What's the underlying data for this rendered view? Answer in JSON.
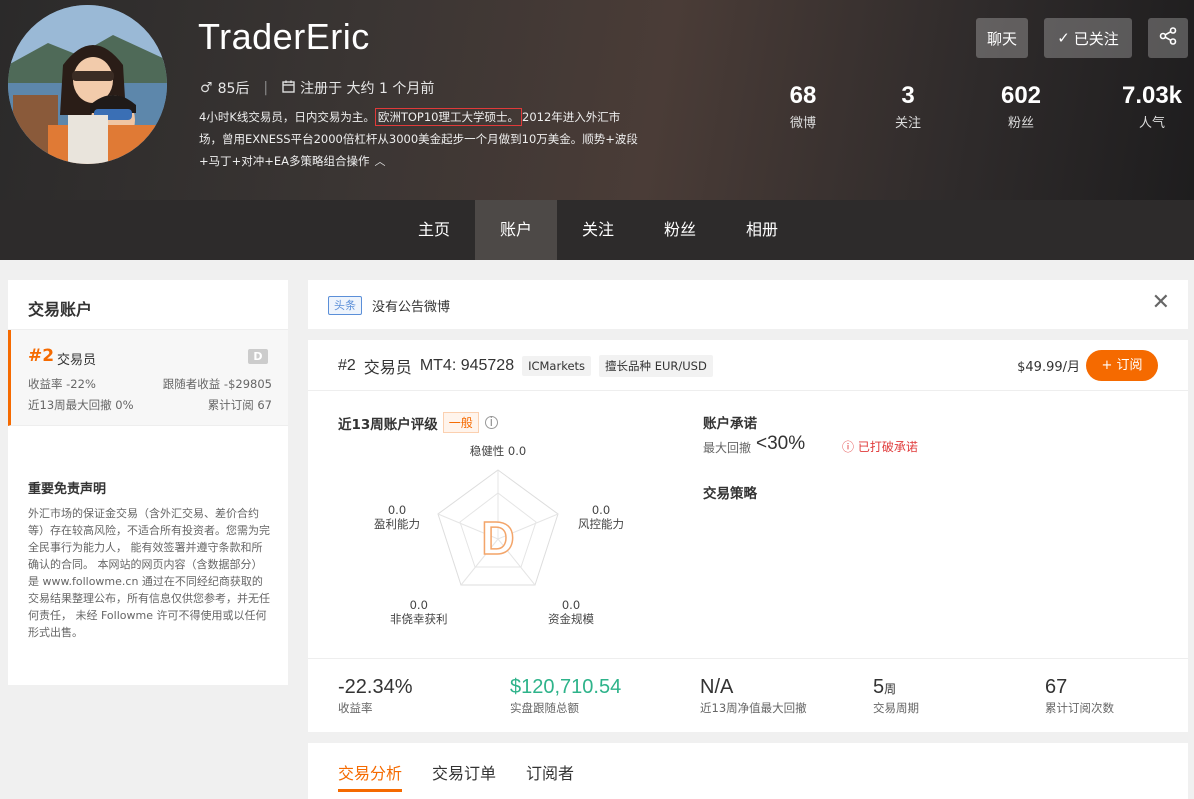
{
  "header": {
    "username": "TraderEric",
    "gender_icon": "male-icon",
    "age_group": "85后",
    "calendar_icon": "calendar-icon",
    "registered": "注册于 大约 1 个月前",
    "bio_part1": "4小时K线交易员，日内交易为主。",
    "bio_highlight": "欧洲TOP10理工大学硕士。",
    "bio_part2": "2012年进入外汇市场，曾用EXNESS平台2000倍杠杆从3000美金起步一个月做到10万美金。顺势+波段+马丁+对冲+EA多策略组合操作",
    "collapse_icon": "chevron-up-icon",
    "buttons": {
      "chat": "聊天",
      "follow": "已关注",
      "follow_icon": "check-icon",
      "share_icon": "share-icon"
    },
    "stats": [
      {
        "num": "68",
        "label": "微博"
      },
      {
        "num": "3",
        "label": "关注"
      },
      {
        "num": "602",
        "label": "粉丝"
      },
      {
        "num": "7.03k",
        "label": "人气"
      }
    ]
  },
  "nav": {
    "tabs": [
      "主页",
      "账户",
      "关注",
      "粉丝",
      "相册"
    ],
    "active": "账户"
  },
  "sidebar": {
    "title": "交易账户",
    "account": {
      "rank": "#2",
      "rank_label": "交易员",
      "grade": "D",
      "return_label": "收益率 -22%",
      "follower_profit_label": "跟随者收益 -$29805",
      "drawdown_label": "近13周最大回撤 0%",
      "subs_label": "累计订阅 67"
    },
    "disclaimer_title": "重要免责声明",
    "disclaimer_text": "外汇市场的保证金交易（含外汇交易、差价合约等）存在较高风险，不适合所有投资者。您需为完全民事行为能力人， 能有效签署并遵守条款和所确认的合同。 本网站的网页内容（含数据部分）是 www.followme.cn 通过在不同经纪商获取的交易结果整理公布，所有信息仅供您参考，并无任何责任， 未经 Followme 许可不得使用或以任何形式出售。"
  },
  "announcement": {
    "tag": "头条",
    "text": "没有公告微博",
    "close_icon": "close-icon"
  },
  "account_detail": {
    "rank": "#2",
    "role": "交易员",
    "mt4": "MT4: 945728",
    "broker": "ICMarkets",
    "specialty": "擅长品种 EUR/USD",
    "price": "$49.99/月",
    "subscribe": "+ 订阅",
    "rating_title": "近13周账户评级",
    "rating_grade": "一般",
    "info_icon": "info-icon",
    "radar_grade": "D",
    "radar": [
      {
        "label": "稳健性",
        "value": "0.0"
      },
      {
        "label": "风控能力",
        "value": "0.0"
      },
      {
        "label": "资金规模",
        "value": "0.0"
      },
      {
        "label": "非侥幸获利",
        "value": "0.0"
      },
      {
        "label": "盈利能力",
        "value": "0.0"
      }
    ],
    "promise_title": "账户承诺",
    "promise_label": "最大回撤",
    "promise_value": "<30%",
    "promise_warning": "已打破承诺",
    "warning_icon": "alert-circle-icon",
    "strategy_title": "交易策略",
    "metrics": [
      {
        "value": "-22.34%",
        "label": "收益率"
      },
      {
        "value": "$120,710.54",
        "label": "实盘跟随总额"
      },
      {
        "value": "N/A",
        "label": "近13周净值最大回撤"
      },
      {
        "value": "5",
        "unit": "周",
        "label": "交易周期"
      },
      {
        "value": "67",
        "label": "累计订阅次数"
      }
    ]
  },
  "bottom_tabs": {
    "items": [
      "交易分析",
      "交易订单",
      "订阅者"
    ],
    "active": "交易分析"
  }
}
